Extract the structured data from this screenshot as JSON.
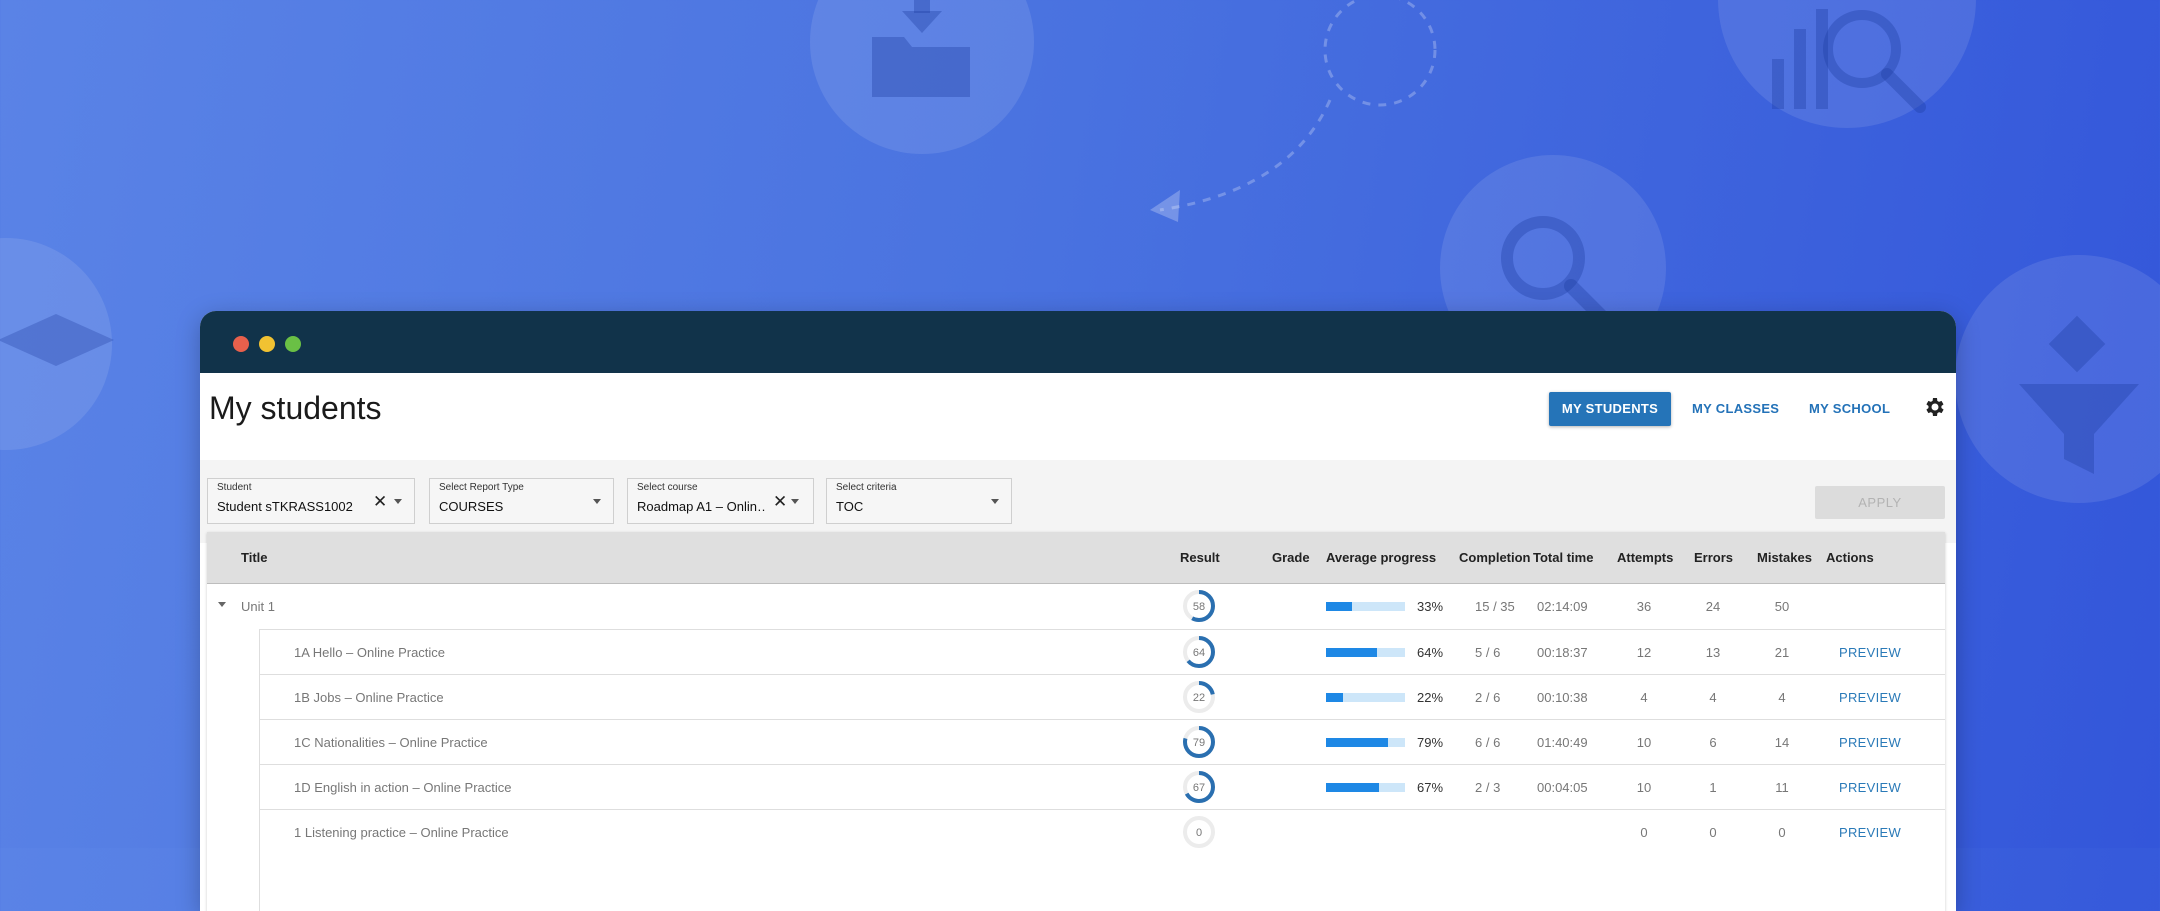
{
  "window": {
    "title": ""
  },
  "header": {
    "title": "My students",
    "nav": [
      {
        "label": "MY STUDENTS",
        "active": true
      },
      {
        "label": "MY CLASSES",
        "active": false
      },
      {
        "label": "MY SCHOOL",
        "active": false
      }
    ],
    "settings_icon": "gear-icon"
  },
  "filters": {
    "student": {
      "label": "Student",
      "value": "Student sTKRASS1002",
      "clear": "✕"
    },
    "report_type": {
      "label": "Select Report Type",
      "value": "COURSES"
    },
    "course": {
      "label": "Select course",
      "value": "Roadmap A1 – Onlin…",
      "clear": "✕"
    },
    "criteria": {
      "label": "Select criteria",
      "value": "TOC"
    },
    "apply_label": "APPLY"
  },
  "table": {
    "columns": {
      "title": "Title",
      "result": "Result",
      "grade": "Grade",
      "avg_progress": "Average progress",
      "completion": "Completion",
      "total_time": "Total time",
      "attempts": "Attempts",
      "errors": "Errors",
      "mistakes": "Mistakes",
      "actions": "Actions"
    },
    "rows": [
      {
        "title": "Unit 1",
        "result": "58",
        "progress": 33,
        "progress_label": "33%",
        "completion": "15 / 35",
        "time": "02:14:09",
        "attempts": "36",
        "errors": "24",
        "mistakes": "50",
        "action": ""
      },
      {
        "title": "1A Hello – Online Practice",
        "result": "64",
        "progress": 64,
        "progress_label": "64%",
        "completion": "5 / 6",
        "time": "00:18:37",
        "attempts": "12",
        "errors": "13",
        "mistakes": "21",
        "action": "PREVIEW"
      },
      {
        "title": "1B Jobs – Online Practice",
        "result": "22",
        "progress": 22,
        "progress_label": "22%",
        "completion": "2 / 6",
        "time": "00:10:38",
        "attempts": "4",
        "errors": "4",
        "mistakes": "4",
        "action": "PREVIEW"
      },
      {
        "title": "1C Nationalities – Online Practice",
        "result": "79",
        "progress": 79,
        "progress_label": "79%",
        "completion": "6 / 6",
        "time": "01:40:49",
        "attempts": "10",
        "errors": "6",
        "mistakes": "14",
        "action": "PREVIEW"
      },
      {
        "title": "1D English in action – Online Practice",
        "result": "67",
        "progress": 67,
        "progress_label": "67%",
        "completion": "2 / 3",
        "time": "00:04:05",
        "attempts": "10",
        "errors": "1",
        "mistakes": "11",
        "action": "PREVIEW"
      },
      {
        "title": "1 Listening practice – Online Practice",
        "result": "0",
        "progress": null,
        "progress_label": "",
        "completion": "",
        "time": "",
        "attempts": "0",
        "errors": "0",
        "mistakes": "0",
        "action": "PREVIEW"
      }
    ]
  },
  "colors": {
    "accent": "#2574b8",
    "ring": "#2a6fb0",
    "progress_fill": "#1e88e5",
    "progress_track": "#cde6f9",
    "titlebar": "#11334a"
  }
}
